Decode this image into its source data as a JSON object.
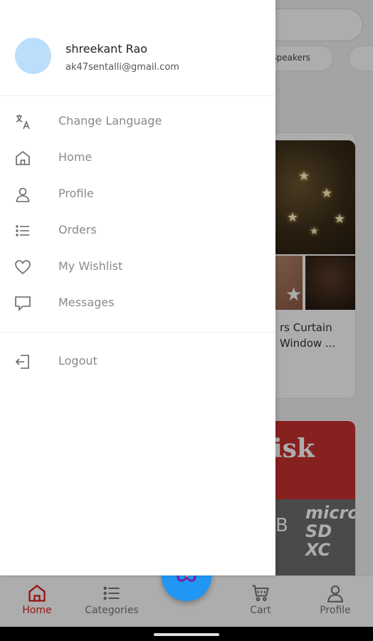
{
  "background": {
    "chip_text": "Speakers",
    "product_title_line1": "rs Curtain",
    "product_title_line2": "Window ...",
    "banner_text": "isk",
    "banner_gb": "B",
    "banner_micro": "micro SD XC"
  },
  "bottom_nav": {
    "items": [
      {
        "label": "Home",
        "icon": "home-icon",
        "active": true
      },
      {
        "label": "Categories",
        "icon": "list-icon",
        "active": false
      },
      {
        "label": "Cart",
        "icon": "cart-icon",
        "active": false
      },
      {
        "label": "Profile",
        "icon": "person-icon",
        "active": false
      }
    ]
  },
  "drawer": {
    "user": {
      "name": "shreekant Rao",
      "email": "ak47sentalli@gmail.com"
    },
    "menu": [
      {
        "label": "Change Language",
        "icon": "translate-icon"
      },
      {
        "label": "Home",
        "icon": "home-icon"
      },
      {
        "label": "Profile",
        "icon": "person-icon"
      },
      {
        "label": "Orders",
        "icon": "list-icon"
      },
      {
        "label": "My Wishlist",
        "icon": "heart-icon"
      },
      {
        "label": "Messages",
        "icon": "message-icon"
      }
    ],
    "logout": {
      "label": "Logout",
      "icon": "logout-icon"
    }
  },
  "colors": {
    "accent_red": "#e21b1b",
    "fab_blue": "#2196f3",
    "avatar_bg": "#bbdefb"
  }
}
